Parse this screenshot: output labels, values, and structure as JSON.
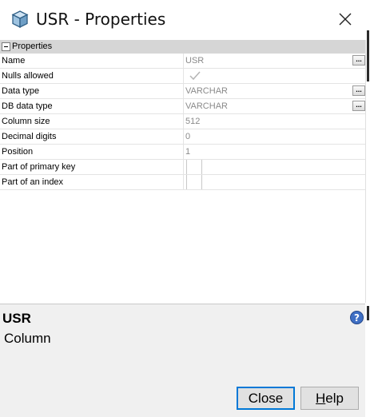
{
  "window": {
    "title": "USR - Properties",
    "icon": "cube-icon",
    "close_icon": "close-icon"
  },
  "property_sheet": {
    "category": "Properties",
    "rows": [
      {
        "name": "Name",
        "value": "USR",
        "has_ellipsis": true
      },
      {
        "name": "Nulls allowed",
        "value": "",
        "checkbox_checked": true
      },
      {
        "name": "Data type",
        "value": "VARCHAR",
        "has_ellipsis": true
      },
      {
        "name": "DB data type",
        "value": "VARCHAR",
        "has_ellipsis": true
      },
      {
        "name": "Column size",
        "value": "512"
      },
      {
        "name": "Decimal digits",
        "value": "0"
      },
      {
        "name": "Position",
        "value": "1"
      },
      {
        "name": "Part of primary key",
        "value": ""
      },
      {
        "name": "Part of an index",
        "value": ""
      }
    ],
    "ellipsis_label": "..."
  },
  "description": {
    "title": "USR",
    "subtitle": "Column",
    "help_icon": "help-icon"
  },
  "buttons": {
    "close_label": "Close",
    "help_mnemonic": "H",
    "help_rest": "elp"
  },
  "colors": {
    "category_bg": "#d6d6d6",
    "value_text": "#8a8a8a",
    "focus_border": "#0078d7",
    "panel_bg": "#f0f0f0"
  }
}
